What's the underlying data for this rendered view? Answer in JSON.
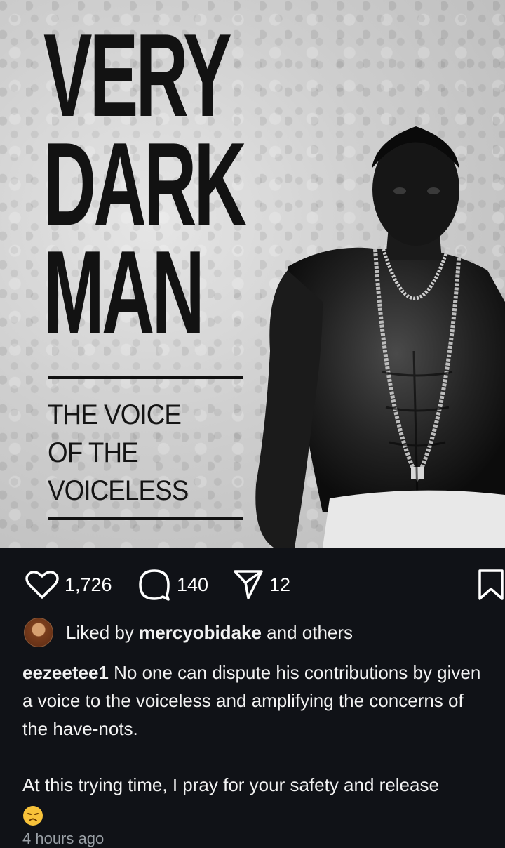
{
  "post": {
    "image": {
      "headline_lines": [
        "VERY",
        "DARK",
        "MAN"
      ],
      "subtitle_lines": [
        "THE VOICE",
        "OF THE",
        "VOICELESS"
      ]
    },
    "actions": {
      "likes_count": "1,726",
      "comments_count": "140",
      "shares_count": "12"
    },
    "liked_by": {
      "prefix": "Liked by ",
      "user": "mercyobidake",
      "suffix": " and others"
    },
    "caption": {
      "username": "eezeetee1",
      "text": " No one can dispute his contributions by given a voice to the voiceless and amplifying the concerns of the have-nots.",
      "second_paragraph": "At this trying time, I pray for your safety and release",
      "emoji": "disappointed-face-emoji"
    },
    "timestamp": "4 hours ago"
  },
  "colors": {
    "background": "#101217",
    "text": "#ffffff",
    "emoji": "#f7c23a"
  }
}
